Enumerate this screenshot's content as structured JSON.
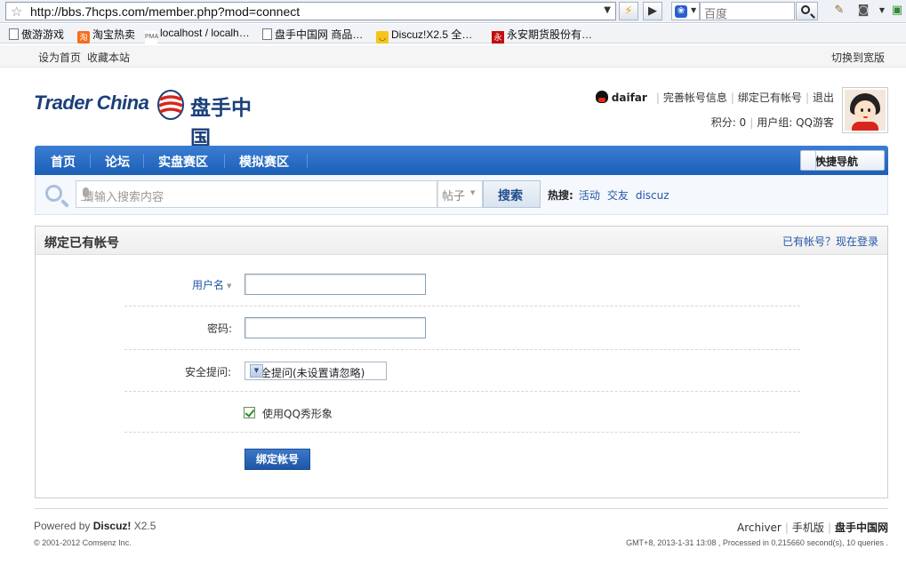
{
  "browser": {
    "url": "http://bbs.7hcps.com/member.php?mod=connect",
    "search_engine_placeholder": "百度",
    "bookmarks": [
      {
        "label": "傲游游戏",
        "icon": "page-icon"
      },
      {
        "label": "淘宝热卖",
        "icon": "taobao-icon",
        "glyph": "淘"
      },
      {
        "label": "localhost / localh…",
        "icon": "phpmyadmin-icon",
        "glyph": "PMA"
      },
      {
        "label": "盘手中国网 商品…",
        "icon": "page-icon"
      },
      {
        "label": "Discuz!X2.5 全…",
        "icon": "discuz-icon"
      },
      {
        "label": "永安期货股份有…",
        "icon": "yongan-icon",
        "glyph": "永"
      }
    ]
  },
  "topbar": {
    "set_homepage": "设为首页",
    "bookmark_site": "收藏本站",
    "switch_wide": "切换到宽版"
  },
  "header": {
    "logo_en": "Trader China",
    "logo_cn": "盘手中国",
    "username": "daifar",
    "links": [
      "完善帐号信息",
      "绑定已有帐号",
      "退出"
    ],
    "points_label": "积分: 0",
    "group_label": "用户组: QQ游客"
  },
  "nav": {
    "items": [
      "首页",
      "论坛",
      "实盘赛区",
      "模拟赛区"
    ],
    "quick_nav": "快捷导航"
  },
  "search": {
    "placeholder": "请输入搜索内容",
    "type": "帖子",
    "button": "搜索",
    "hot_label": "热搜:",
    "hot_items": [
      "活动",
      "交友",
      "discuz"
    ]
  },
  "panel": {
    "title": "绑定已有帐号",
    "login_link": "已有帐号？现在登录",
    "username_label": "用户名",
    "username_value": "",
    "password_label": "密码:",
    "password_value": "",
    "security_label": "安全提问:",
    "security_value": "安全提问(未设置请忽略)",
    "qq_avatar_label": "使用QQ秀形象",
    "qq_avatar_checked": true,
    "submit": "绑定帐号"
  },
  "footer": {
    "powered_prefix": "Powered by",
    "powered_brand": "Discuz!",
    "version": "X2.5",
    "copyright": "© 2001-2012 Comsenz Inc.",
    "links": [
      "Archiver",
      "手机版",
      "盘手中国网"
    ],
    "info": "GMT+8, 2013-1-31 13:08 , Processed in 0.215660 second(s), 10 queries ."
  },
  "colors": {
    "nav_blue": "#1b5fb8",
    "link_blue": "#2257a8",
    "logo_blue": "#1b3f7a",
    "logo_red": "#d9261c"
  }
}
